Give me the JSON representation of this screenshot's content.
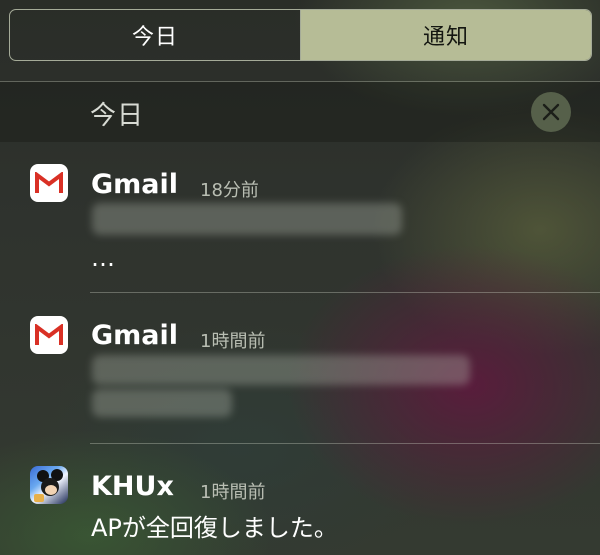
{
  "tabs": [
    {
      "label": "今日",
      "active": true
    },
    {
      "label": "通知",
      "active": false
    }
  ],
  "section": {
    "title": "今日"
  },
  "notifications": [
    {
      "app": "Gmail",
      "icon": "gmail-icon",
      "time": "18分前",
      "body": "…"
    },
    {
      "app": "Gmail",
      "icon": "gmail-icon",
      "time": "1時間前",
      "body": ""
    },
    {
      "app": "KHUx",
      "icon": "khux-app-icon",
      "time": "1時間前",
      "body": "APが全回復しました。"
    }
  ],
  "colors": {
    "segment_border": "#a5ab98",
    "segment_inactive_bg": "#b6bc96",
    "clear_button_bg": "#56604a",
    "gmail_red": "#d93025"
  }
}
